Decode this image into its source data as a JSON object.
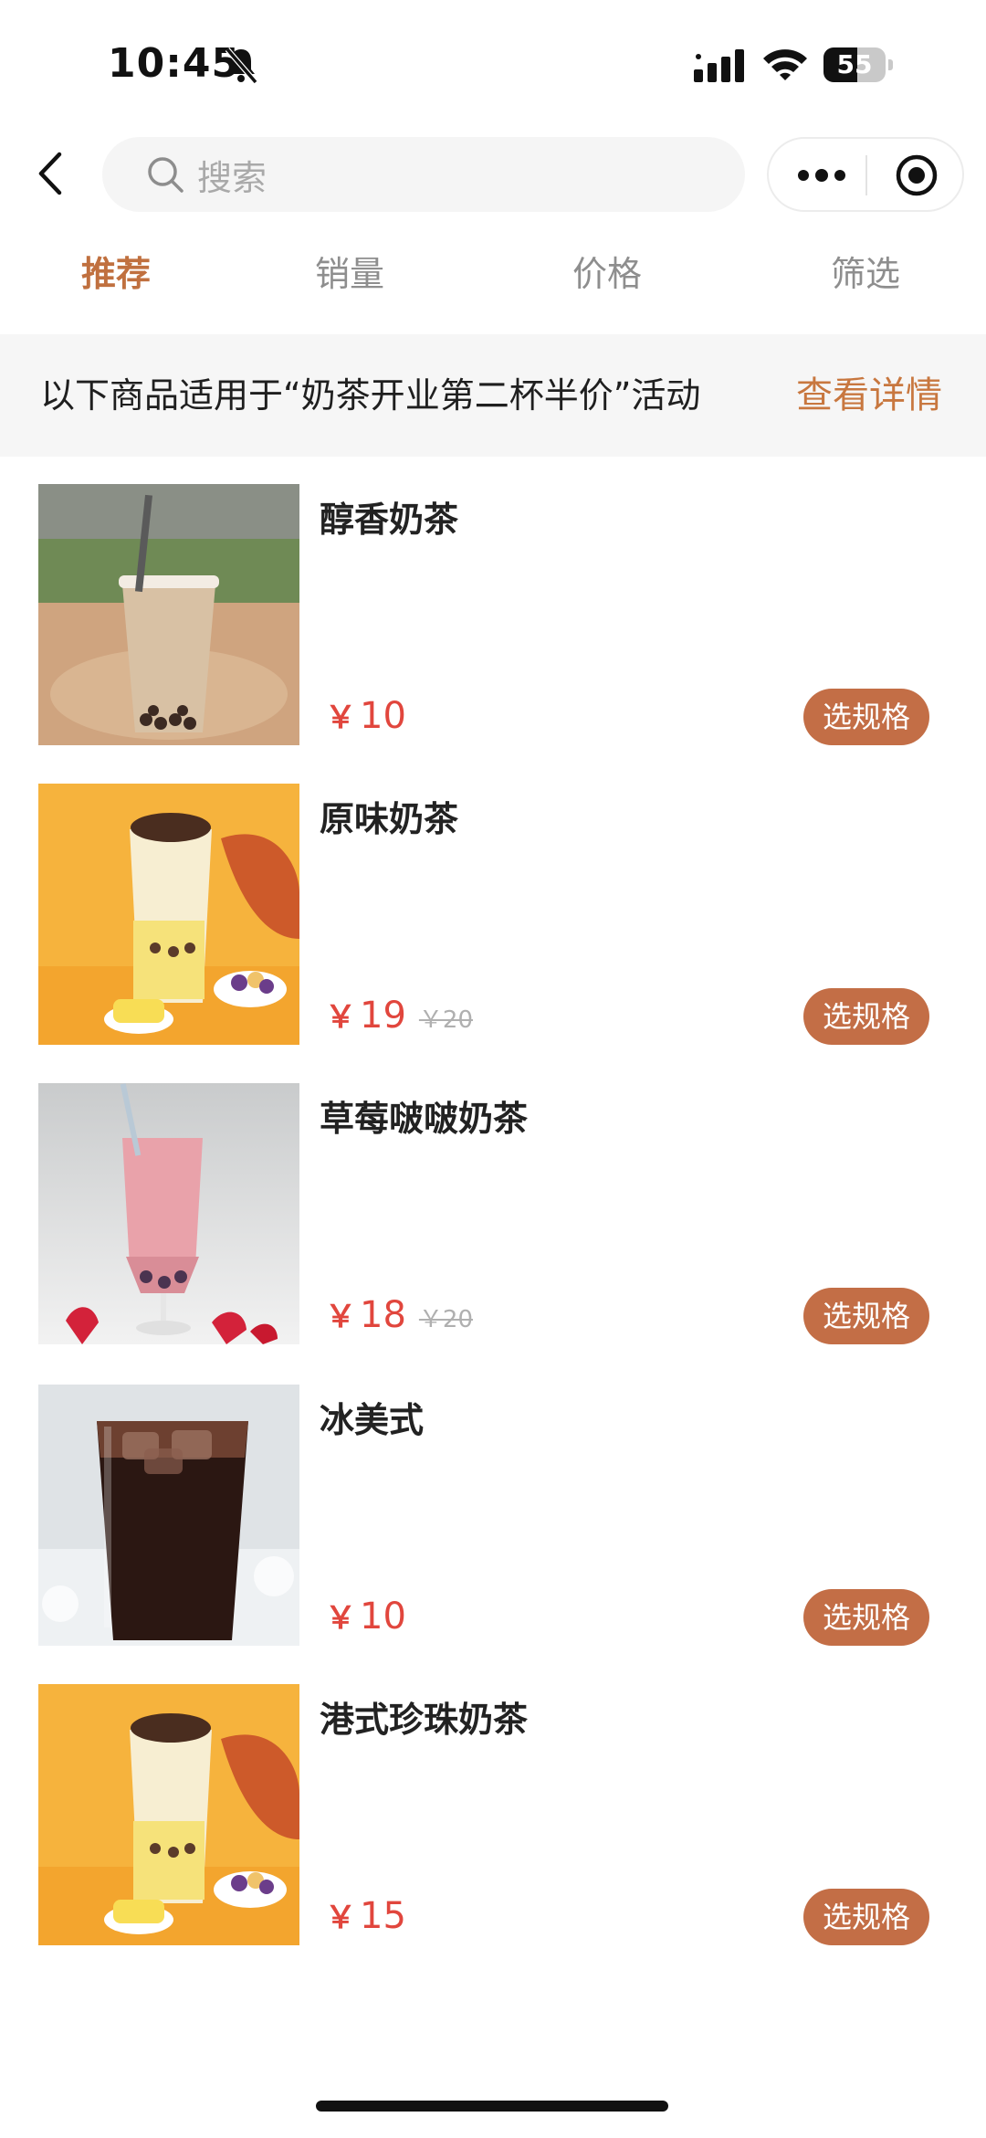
{
  "status": {
    "time": "10:45",
    "battery": "55",
    "battery_level": 0.55
  },
  "nav": {
    "search_placeholder": "搜索",
    "icons": [
      "back-arrow-icon",
      "search-icon",
      "more-icon",
      "target-icon"
    ]
  },
  "tabs": [
    {
      "label": "推荐",
      "active": true
    },
    {
      "label": "销量",
      "active": false
    },
    {
      "label": "价格",
      "active": false
    },
    {
      "label": "筛选",
      "active": false
    }
  ],
  "promo": {
    "text": "以下商品适用于“奶茶开业第二杯半价”活动",
    "link": "查看详情"
  },
  "colors": {
    "accent": "#c0703f",
    "price": "#e1463d",
    "button": "#c36e46"
  },
  "products": [
    {
      "name": "醇香奶茶",
      "currency": "￥",
      "price": "10",
      "original_price": "",
      "button": "选规格",
      "image": "milk-tea-cup"
    },
    {
      "name": "原味奶茶",
      "currency": "￥",
      "price": "19",
      "original_price": "￥20",
      "button": "选规格",
      "image": "milk-tea-yellow"
    },
    {
      "name": "草莓啵啵奶茶",
      "currency": "￥",
      "price": "18",
      "original_price": "￥20",
      "button": "选规格",
      "image": "strawberry-milk-tea"
    },
    {
      "name": "冰美式",
      "currency": "￥",
      "price": "10",
      "original_price": "",
      "button": "选规格",
      "image": "iced-americano"
    },
    {
      "name": "港式珍珠奶茶",
      "currency": "￥",
      "price": "15",
      "original_price": "",
      "button": "选规格",
      "image": "milk-tea-yellow"
    }
  ]
}
